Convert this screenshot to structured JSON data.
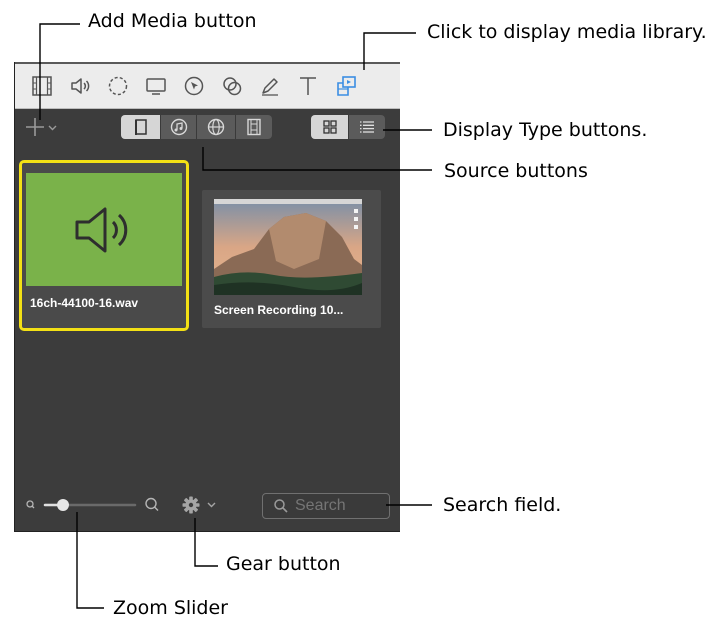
{
  "callouts": {
    "add_media": "Add Media button",
    "media_library": "Click to display media library.",
    "display_type": "Display Type buttons.",
    "source": "Source buttons",
    "search_field": "Search field.",
    "gear": "Gear button",
    "zoom": "Zoom Slider"
  },
  "toolbar": {
    "tools": [
      "media-clip-icon",
      "speaker-icon",
      "transition-icon",
      "screen-icon",
      "cursor-icon",
      "overlap-icon",
      "pencil-icon",
      "text-icon",
      "media-library-icon"
    ],
    "active_tool": "media-library-icon",
    "accent": "#3b8ee3"
  },
  "source_buttons": [
    "device-icon",
    "music-icon",
    "globe-icon",
    "film-strip-icon"
  ],
  "display_type_buttons": [
    "grid-icon",
    "list-icon"
  ],
  "media": [
    {
      "label": "16ch-44100-16.wav",
      "kind": "audio",
      "selected": true,
      "thumb_color": "#7ab24a"
    },
    {
      "label": "Screen Recording 10...",
      "kind": "video",
      "selected": false
    }
  ],
  "bottom": {
    "search_placeholder": "Search",
    "zoom_level": 0.2
  },
  "colors": {
    "panel": "#3c3c3c",
    "selection": "#f3e015"
  }
}
